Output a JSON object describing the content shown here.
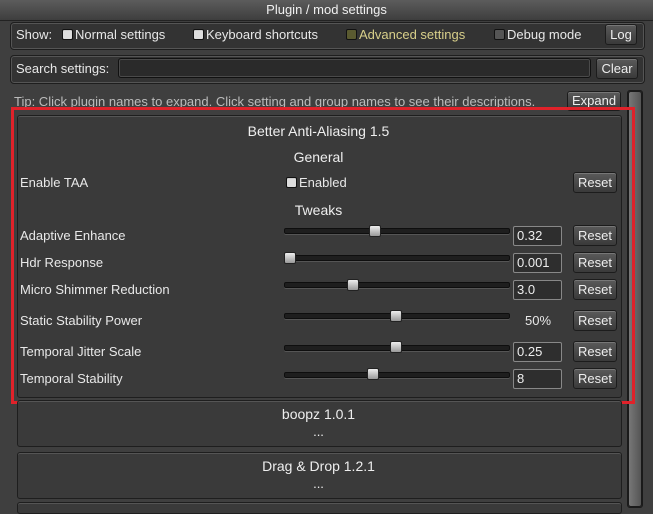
{
  "window": {
    "title": "Plugin / mod settings"
  },
  "toolbar": {
    "show_label": "Show:",
    "filters": [
      {
        "label": "Normal settings",
        "state": "on"
      },
      {
        "label": "Keyboard shortcuts",
        "state": "on"
      },
      {
        "label": "Advanced settings",
        "state": "advanced"
      },
      {
        "label": "Debug mode",
        "state": "off"
      }
    ],
    "log_label": "Log"
  },
  "search": {
    "label": "Search settings:",
    "value": "",
    "clear_label": "Clear"
  },
  "tip": {
    "text": "Tip: Click plugin names to expand. Click setting and group names to see their descriptions.",
    "expand_label": "Expand"
  },
  "plugin": {
    "title": "Better Anti-Aliasing 1.5",
    "groups": [
      {
        "name": "General",
        "settings": [
          {
            "label": "Enable TAA",
            "type": "checkbox",
            "value": "Enabled",
            "reset": "Reset"
          }
        ]
      },
      {
        "name": "Tweaks",
        "settings": [
          {
            "label": "Adaptive Enhance",
            "type": "slider",
            "value": "0.32",
            "reset": "Reset"
          },
          {
            "label": "Hdr Response",
            "type": "slider",
            "value": "0.001",
            "reset": "Reset"
          },
          {
            "label": "Micro Shimmer Reduction",
            "type": "slider",
            "value": "3.0",
            "reset": "Reset"
          },
          {
            "label": "Static Stability Power",
            "type": "slider",
            "value": "50%",
            "reset": "Reset"
          },
          {
            "label": "Temporal Jitter Scale",
            "type": "slider",
            "value": "0.25",
            "reset": "Reset"
          },
          {
            "label": "Temporal Stability",
            "type": "slider",
            "value": "8",
            "reset": "Reset"
          }
        ]
      }
    ]
  },
  "collapsed_plugins": [
    {
      "title": "boopz 1.0.1",
      "ellipsis": "..."
    },
    {
      "title": "Drag & Drop 1.2.1",
      "ellipsis": "..."
    }
  ],
  "colors": {
    "highlight": "#e0222a",
    "advanced_text": "#d8cf8a"
  }
}
